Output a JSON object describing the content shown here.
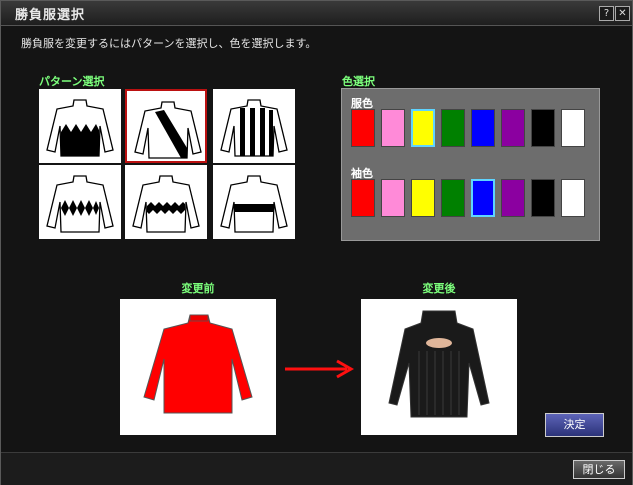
{
  "window": {
    "title": "勝負服選択",
    "help_label": "?",
    "close_label": "✕"
  },
  "instruction": "勝負服を変更するにはパターンを選択し、色を選択します。",
  "pattern_section": {
    "label": "パターン選択",
    "selected_index": 1
  },
  "color_section": {
    "label": "色選択",
    "body_label": "服色",
    "sleeve_label": "袖色",
    "colors": [
      "#ff0000",
      "#ff8ad8",
      "#ffff00",
      "#008000",
      "#0000ff",
      "#8b00a0",
      "#000000",
      "#ffffff"
    ],
    "body_selected": 2,
    "sleeve_selected": 4
  },
  "before": {
    "label": "変更前"
  },
  "after": {
    "label": "変更後"
  },
  "buttons": {
    "decide": "決定",
    "close": "閉じる"
  }
}
